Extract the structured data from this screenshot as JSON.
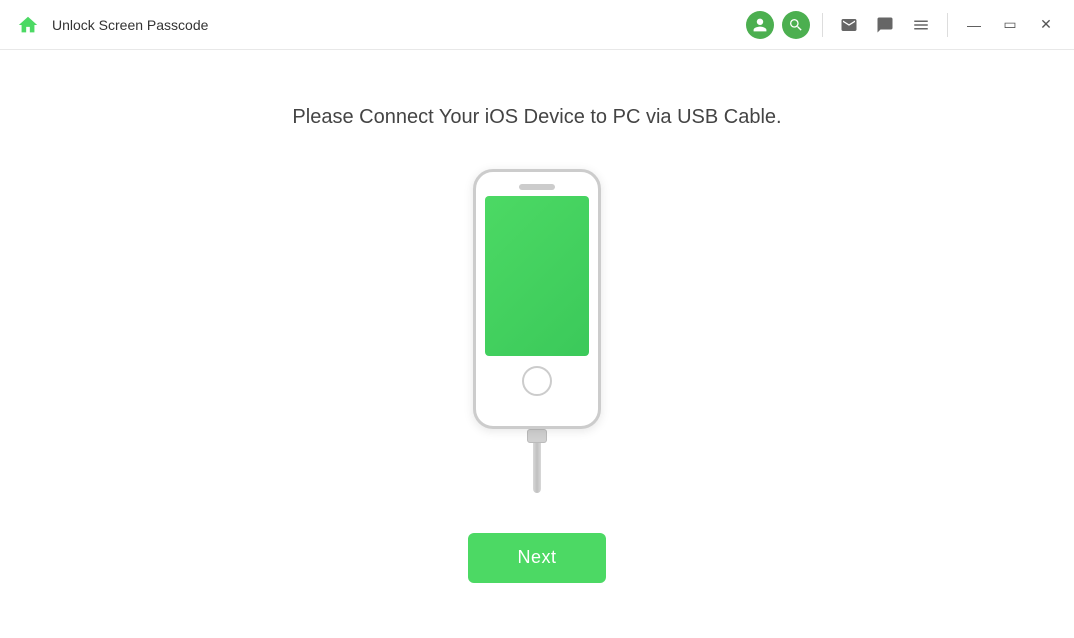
{
  "titlebar": {
    "title": "Unlock Screen Passcode",
    "home_icon": "home-icon",
    "user_icon": "user-icon",
    "search_icon": "search-music-icon",
    "mail_icon": "mail-icon",
    "chat_icon": "chat-icon",
    "menu_icon": "menu-icon",
    "minimize_label": "—",
    "restore_label": "❐",
    "close_label": "✕"
  },
  "main": {
    "instruction": "Please Connect Your iOS Device to PC via USB Cable.",
    "next_button_label": "Next"
  },
  "colors": {
    "accent_green": "#4CD964",
    "dark_green": "#3BC95A"
  }
}
